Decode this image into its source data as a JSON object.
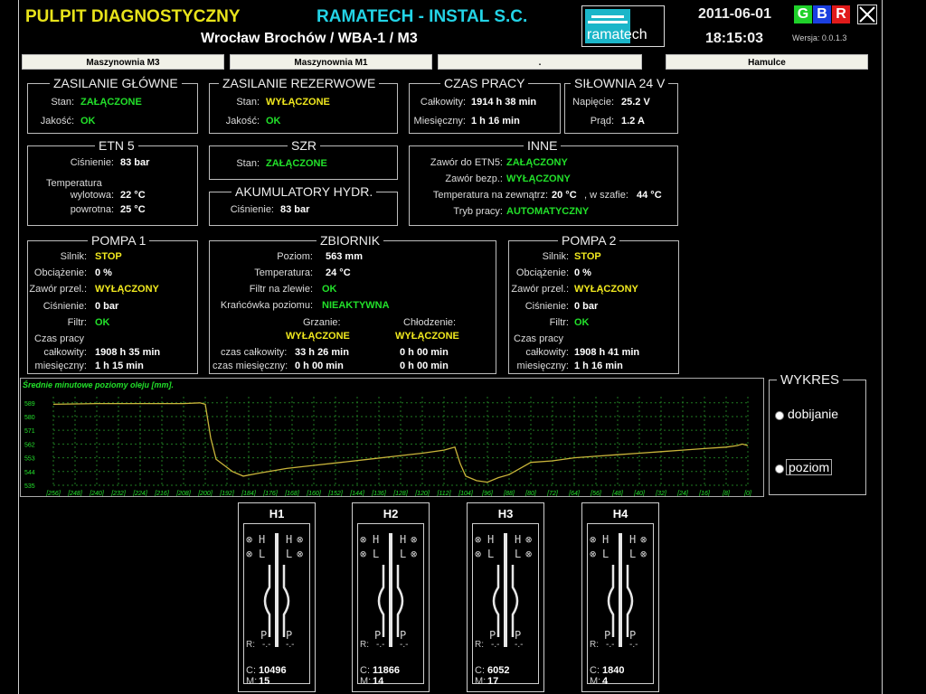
{
  "header": {
    "title": "PULPIT  DIAGNOSTYCZNY",
    "company": "RAMATECH - INSTAL S.C.",
    "location": "Wrocław Brochów / WBA-1 / M3",
    "logo_text": "ramatech",
    "date": "2011-06-01",
    "time": "18:15:03",
    "version": "Wersja: 0.0.1.3",
    "btn_g": "G",
    "btn_b": "B",
    "btn_r": "R",
    "colors": {
      "g": "#1fd12a",
      "b": "#1a3fe0",
      "r": "#e01a1a"
    }
  },
  "tabs": [
    "Maszynownia M3",
    "Maszynownia M1",
    ".",
    "Hamulce"
  ],
  "zasilanie_glowne": {
    "title": "ZASILANIE GŁÓWNE",
    "stan_label": "Stan:",
    "stan": "ZAŁĄCZONE",
    "jakosc_label": "Jakość:",
    "jakosc": "OK"
  },
  "zasilanie_rez": {
    "title": "ZASILANIE REZERWOWE",
    "stan_label": "Stan:",
    "stan": "WYŁĄCZONE",
    "jakosc_label": "Jakość:",
    "jakosc": "OK"
  },
  "czas_pracy": {
    "title": "CZAS PRACY",
    "calk_label": "Całkowity:",
    "calk": "1914 h  38 min",
    "mies_label": "Miesięczny:",
    "mies": "1 h  16 min"
  },
  "silownia": {
    "title": "SIŁOWNIA 24 V",
    "nap_label": "Napięcie:",
    "nap": "25.2 V",
    "prad_label": "Prąd:",
    "prad": "1.2  A"
  },
  "etn5": {
    "title": "ETN 5",
    "cis_label": "Ciśnienie:",
    "cis": "83 bar",
    "temp_label": "Temperatura",
    "wyl_label": "wylotowa:",
    "wyl": "22 °C",
    "pow_label": "powrotna:",
    "pow": "25 °C"
  },
  "szr": {
    "title": "SZR",
    "stan_label": "Stan:",
    "stan": "ZAŁĄCZONE"
  },
  "akumulatory": {
    "title": "AKUMULATORY HYDR.",
    "cis_label": "Ciśnienie:",
    "cis": "83 bar"
  },
  "inne": {
    "title": "INNE",
    "zawor_label": "Zawór do ETN5:",
    "zawor": "ZAŁĄCZONY",
    "bezp_label": "Zawór bezp.:",
    "bezp": "WYŁĄCZONY",
    "temp_label": "Temperatura na zewnątrz:",
    "temp": "20 °C",
    "szafa_label": ", w szafie:",
    "szafa": "44 °C",
    "tryb_label": "Tryb pracy:",
    "tryb": "AUTOMATYCZNY"
  },
  "pompa1": {
    "title": "POMPA 1",
    "silnik_label": "Silnik:",
    "silnik": "STOP",
    "obc_label": "Obciążenie:",
    "obc": "0 %",
    "zawor_label": "Zawór przel.:",
    "zawor": "WYŁĄCZONY",
    "cis_label": "Ciśnienie:",
    "cis": "0 bar",
    "filtr_label": "Filtr:",
    "filtr": "OK",
    "czas_label": "Czas pracy",
    "calk_label": "całkowity:",
    "calk": "1908 h  35 min",
    "mies_label": "miesięczny:",
    "mies": "1 h  15 min"
  },
  "zbiornik": {
    "title": "ZBIORNIK",
    "poziom_label": "Poziom:",
    "poziom": "563 mm",
    "temp_label": "Temperatura:",
    "temp": "24 °C",
    "filtr_label": "Filtr na zlewie:",
    "filtr": "OK",
    "krancowka_label": "Krańcówka poziomu:",
    "krancowka": "NIEAKTYWNA",
    "grzanie_label": "Grzanie:",
    "grzanie": "WYŁĄCZONE",
    "chlodzenie_label": "Chłodzenie:",
    "chlodzenie": "WYŁĄCZONE",
    "czas_calk_label": "czas całkowity:",
    "grz_calk": "33 h  26 min",
    "chl_calk": "0 h  00 min",
    "czas_mies_label": "czas miesięczny:",
    "grz_mies": "0 h  00 min",
    "chl_mies": "0 h  00 min"
  },
  "pompa2": {
    "title": "POMPA 2",
    "silnik_label": "Silnik:",
    "silnik": "STOP",
    "obc_label": "Obciążenie:",
    "obc": "0 %",
    "zawor_label": "Zawór przel.:",
    "zawor": "WYŁĄCZONY",
    "cis_label": "Ciśnienie:",
    "cis": "0 bar",
    "filtr_label": "Filtr:",
    "filtr": "OK",
    "czas_label": "Czas pracy",
    "calk_label": "całkowity:",
    "calk": "1908 h  41 min",
    "mies_label": "miesięczny:",
    "mies": "1 h  16 min"
  },
  "wykres": {
    "title": "WYKRES",
    "opt1": "dobijanie",
    "opt2": "poziom"
  },
  "chart_data": {
    "type": "line",
    "title": "Średnie minutowe poziomy oleju [mm].",
    "ylim": [
      535,
      593
    ],
    "yticks": [
      "589",
      "580",
      "571",
      "562",
      "553",
      "544",
      "535"
    ],
    "xticks": [
      "[256]",
      "[248]",
      "[240]",
      "[232]",
      "[224]",
      "[216]",
      "[208]",
      "[200]",
      "[192]",
      "[184]",
      "[176]",
      "[168]",
      "[160]",
      "[152]",
      "[144]",
      "[136]",
      "[128]",
      "[120]",
      "[112]",
      "[104]",
      "[96]",
      "[88]",
      "[80]",
      "[72]",
      "[64]",
      "[56]",
      "[48]",
      "[40]",
      "[32]",
      "[24]",
      "[16]",
      "[8]",
      "[0]"
    ],
    "xlim": [
      256,
      0
    ],
    "grid": true,
    "line_color": "#c9b43a",
    "series": [
      {
        "x": [
          256,
          240,
          224,
          208,
          202,
          200,
          198,
          196,
          193,
          190,
          186,
          180,
          170,
          160,
          150,
          140,
          130,
          120,
          112,
          108,
          106,
          104,
          100,
          96,
          92,
          88,
          84,
          80,
          72,
          64,
          56,
          48,
          40,
          32,
          24,
          16,
          8,
          4,
          2,
          0
        ],
        "values": [
          588,
          588.5,
          588.5,
          588.5,
          589,
          588,
          566,
          552,
          548,
          544,
          541,
          543,
          546,
          548,
          550,
          552,
          554,
          556,
          558,
          560,
          549,
          541,
          538,
          537,
          540,
          542,
          546,
          550,
          551,
          553,
          554,
          555,
          556,
          557,
          558,
          559,
          560,
          561,
          562,
          561
        ]
      }
    ]
  },
  "hcards": [
    {
      "name": "H1",
      "h": "H",
      "l": "L",
      "p": "P",
      "r_label": "R:",
      "r1": "-.-",
      "r2": "-.-",
      "c_label": "C:",
      "c": "10496",
      "m_label": "M:",
      "m": "15"
    },
    {
      "name": "H2",
      "h": "H",
      "l": "L",
      "p": "P",
      "r_label": "R:",
      "r1": "-.-",
      "r2": "-.-",
      "c_label": "C:",
      "c": "11866",
      "m_label": "M:",
      "m": "14"
    },
    {
      "name": "H3",
      "h": "H",
      "l": "L",
      "p": "P",
      "r_label": "R:",
      "r1": "-.-",
      "r2": "-.-",
      "c_label": "C:",
      "c": "6052",
      "m_label": "M:",
      "m": "17"
    },
    {
      "name": "H4",
      "h": "H",
      "l": "L",
      "p": "P",
      "r_label": "R:",
      "r1": "-.-",
      "r2": "-.-",
      "c_label": "C:",
      "c": "1840",
      "m_label": "M:",
      "m": "4"
    }
  ]
}
